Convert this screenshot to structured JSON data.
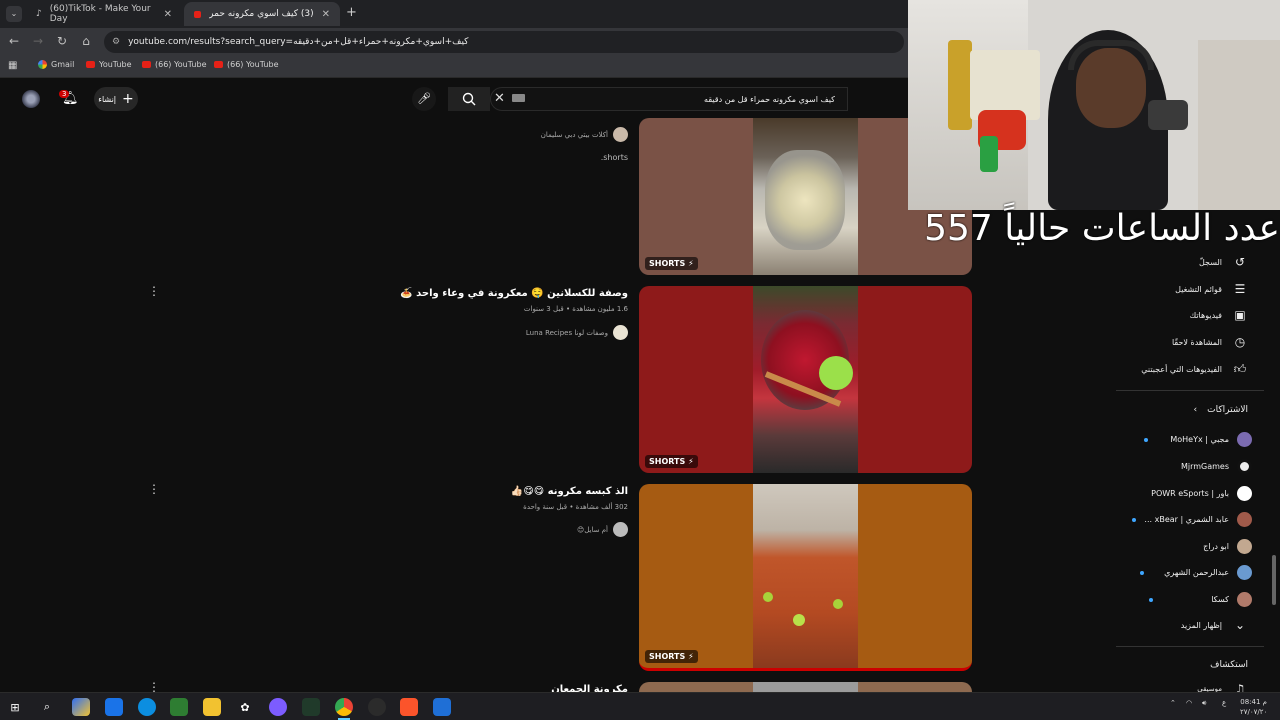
{
  "browser": {
    "tabs": [
      {
        "title": "(60)TikTok - Make Your Day",
        "active": false
      },
      {
        "title": "(3) كيف اسوي مكرونه حمراء قل ...",
        "active": true
      }
    ],
    "new_tab": "+",
    "url": "youtube.com/results?search_query=كيف+اسوي+مكرونه+حمراء+قل+من+دقيقه",
    "bookmarks": [
      "Gmail",
      "YouTube",
      "(66) YouTube",
      "(66) YouTube"
    ]
  },
  "yt_header": {
    "search_value": "كيف اسوي مكرونه حمراء قل من دقيقه",
    "create_label": "إنشاء",
    "notifications_count": "3"
  },
  "results": [
    {
      "channel": "أكلات بيتي دبي سليمان",
      "title": "",
      "meta": "",
      "desc": "shorts.",
      "badge": "SHORTS"
    },
    {
      "title": "وصفة للكسلانين 🤤 معكرونة في وعاء واحد 🍝",
      "meta": "1.6 مليون مشاهدة • قبل 3 سنوات",
      "channel": "وصفات لونا Luna Recipes",
      "badge": "SHORTS"
    },
    {
      "title": "الذ كبسه مكرونه 😋😋👍🏻",
      "meta": "302 ألف مشاهدة • قبل سنة واحدة",
      "channel": "أم سايل😊",
      "badge": "SHORTS"
    },
    {
      "title": "مكرونة الجمعان",
      "meta": "",
      "channel": "",
      "badge": ""
    }
  ],
  "sidebar": {
    "items": [
      {
        "label": "السجلّ",
        "icon": "history-icon"
      },
      {
        "label": "قوائم التشغيل",
        "icon": "playlist-icon"
      },
      {
        "label": "فيديوهاتك",
        "icon": "your-videos-icon"
      },
      {
        "label": "المشاهدة لاحقًا",
        "icon": "watch-later-icon"
      },
      {
        "label": "الفيديوهات التي أعجبتني",
        "icon": "like-icon"
      }
    ],
    "subscriptions_title": "الاشتراكات",
    "subscriptions": [
      {
        "name": "مجبي | MoHeYx",
        "dot": true
      },
      {
        "name": "MjrmGames",
        "dot": false
      },
      {
        "name": "باور | POWR eSports",
        "dot": false
      },
      {
        "name": "عابد الشمري | xBear ...",
        "dot": true
      },
      {
        "name": "ابو دراج",
        "dot": false
      },
      {
        "name": "عبدالرحمن الشهري",
        "dot": true
      },
      {
        "name": "كسكا",
        "dot": true
      }
    ],
    "show_more": "إظهار المزيد",
    "explore_title": "استكشاف",
    "explore_first": "موسيقى"
  },
  "overlay": {
    "hours_text": "عدد الساعات حالياً 557"
  },
  "taskbar": {
    "time": "08:41 م",
    "date": "٢٧/٠٧/٢٠",
    "lang": "ع"
  },
  "colors": {
    "accent_red": "#cc0000",
    "thumb2": "#8e1a1a",
    "thumb3": "#a65b12",
    "thumb1": "#7a5246"
  }
}
